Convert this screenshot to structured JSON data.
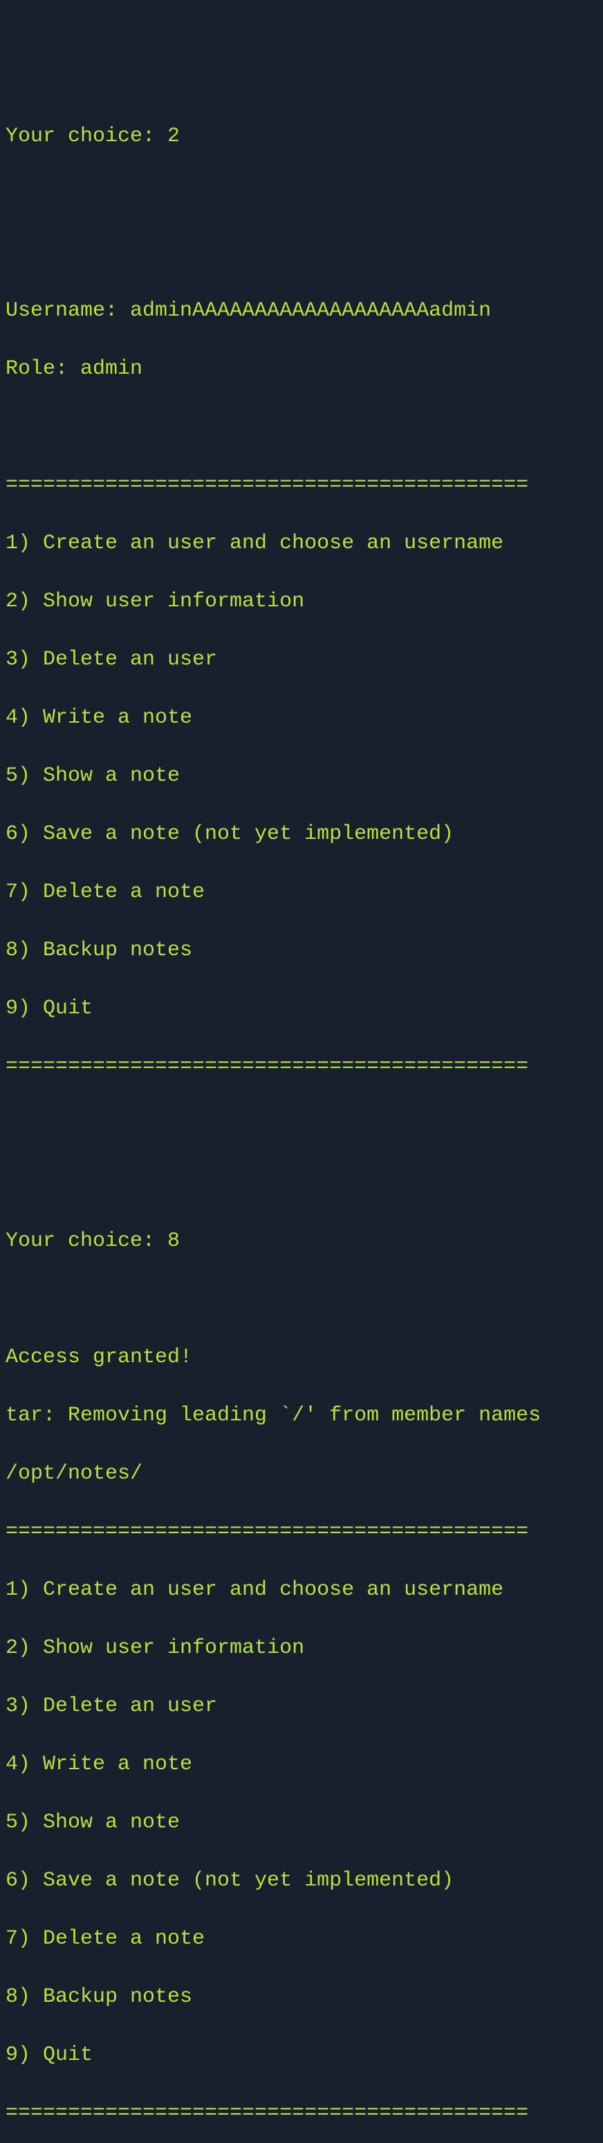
{
  "block1": {
    "choice_label": "Your choice: ",
    "choice_value": "2"
  },
  "user_info": {
    "username_label": "Username: ",
    "username": "adminAAAAAAAAAAAAAAAAAAAadmin",
    "role_label": "Role: ",
    "role": "admin"
  },
  "divider": "==========================================",
  "menu": {
    "items": [
      "1) Create an user and choose an username",
      "2) Show user information",
      "3) Delete an user",
      "4) Write a note",
      "5) Show a note",
      "6) Save a note (not yet implemented)",
      "7) Delete a note",
      "8) Backup notes",
      "9) Quit"
    ]
  },
  "block2": {
    "choice_label": "Your choice: ",
    "choice_value": "8"
  },
  "output": {
    "access": "Access granted!",
    "tar": "tar: Removing leading `/' from member names",
    "path": "/opt/notes/"
  }
}
